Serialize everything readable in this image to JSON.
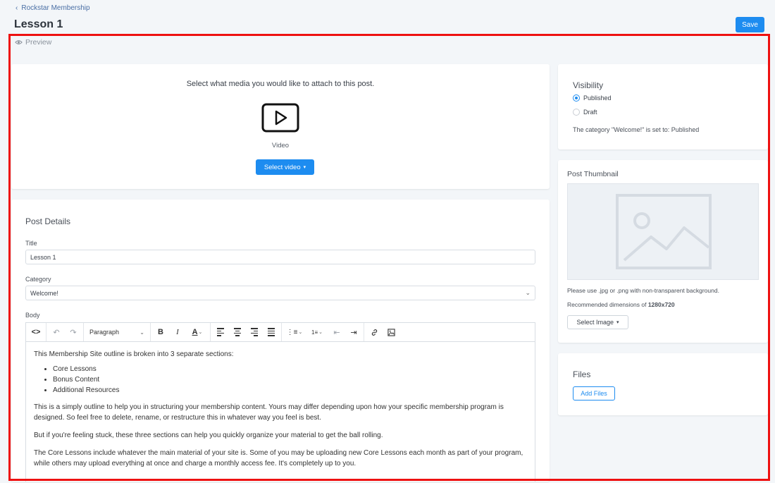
{
  "header": {
    "breadcrumb": "Rockstar Membership",
    "title": "Lesson 1",
    "save_label": "Save",
    "preview_label": "Preview"
  },
  "media": {
    "prompt": "Select what media you would like to attach to this post.",
    "video_label": "Video",
    "select_video_label": "Select video"
  },
  "details": {
    "heading": "Post Details",
    "title_label": "Title",
    "title_value": "Lesson 1",
    "category_label": "Category",
    "category_value": "Welcome!",
    "body_label": "Body",
    "paragraph_format": "Paragraph",
    "body": {
      "intro": "This Membership Site outline is broken into 3 separate sections:",
      "sections": [
        "Core Lessons",
        "Bonus Content",
        "Additional Resources"
      ],
      "p1": "This is a simply outline to help you in structuring your membership content. Yours may differ depending upon how your specific membership program is designed. So feel free to delete, rename, or restructure this in whatever way you feel is best.",
      "p2": "But if you're feeling stuck, these three sections can help you quickly organize your material to get the ball rolling.",
      "p3": "The Core Lessons include whatever the main material of your site is. Some of you may be uploading new Core Lessons each month as part of your program, while others may upload everything at once and charge a monthly access fee. It's completely up to you."
    }
  },
  "visibility": {
    "heading": "Visibility",
    "options": [
      "Published",
      "Draft"
    ],
    "selected": "Published",
    "note": "The category \"Welcome!\" is set to: Published"
  },
  "thumbnail": {
    "heading": "Post Thumbnail",
    "note_format": "Please use .jpg or .png with non-transparent background.",
    "note_dims_prefix": "Recommended dimensions of ",
    "note_dims_value": "1280x720",
    "select_image_label": "Select Image"
  },
  "files": {
    "heading": "Files",
    "add_files_label": "Add Files"
  },
  "colors": {
    "accent": "#1d8cf0",
    "highlight": "#ee1111",
    "background": "#f3f6f9"
  }
}
